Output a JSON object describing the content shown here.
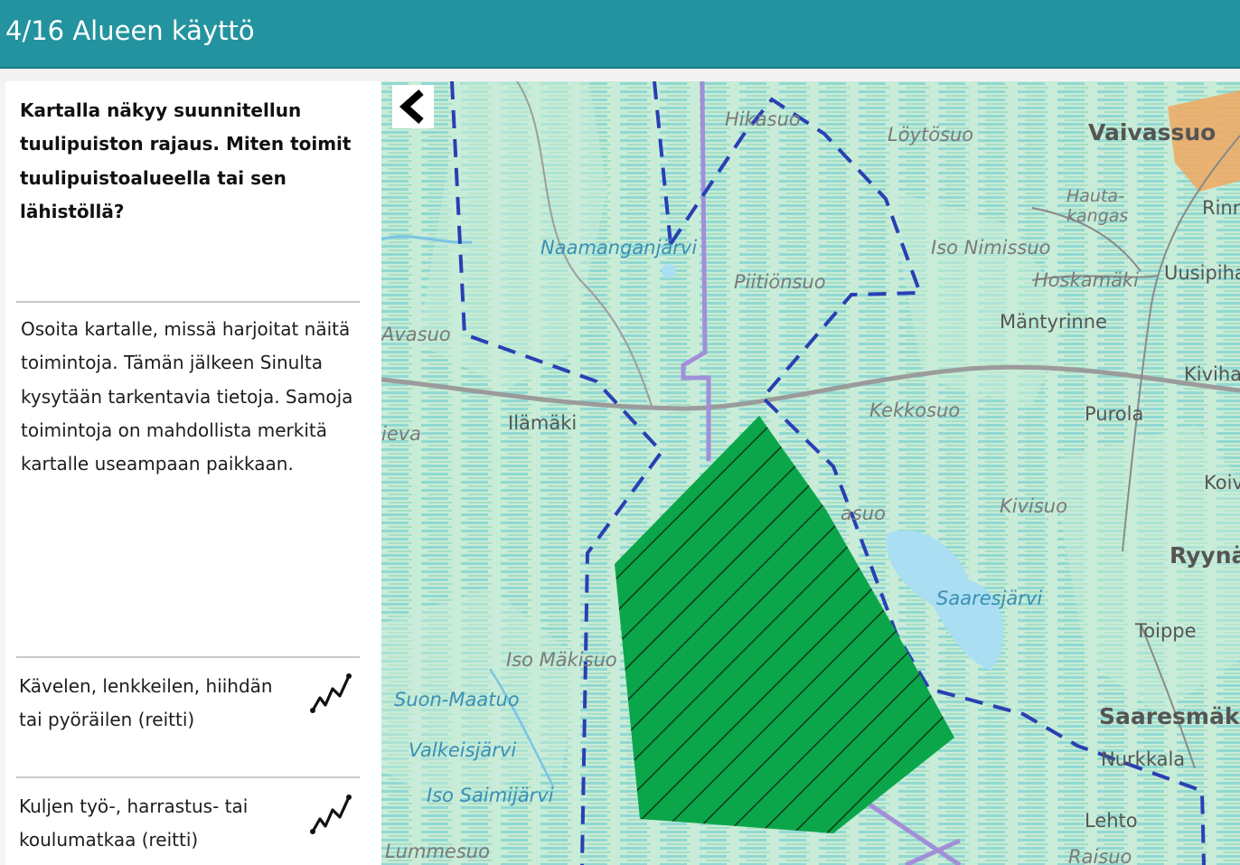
{
  "header": {
    "title": "4/16 Alueen käyttö"
  },
  "panel": {
    "question": "Kartalla näkyy suunnitellun tuulipuiston rajaus. Miten toimit tuulipuistoalueella tai sen lähistöllä?",
    "instructions": "Osoita kartalle, missä harjoitat näitä toimintoja. Tämän jälkeen Sinulta kysytään tarkentavia tietoja. Samoja toimintoja on mahdollista merkitä kartalle useampaan paikkaan.",
    "options": [
      {
        "label": "Kävelen, lenkkeilen, hiihdän tai pyöräilen (reitti)",
        "icon": "route-icon"
      },
      {
        "label": "Kuljen työ-, harrastus- tai koulumatkaa (reitti)",
        "icon": "route-icon"
      }
    ]
  },
  "map": {
    "collapse_icon": "chevron-left-icon",
    "colors": {
      "area_fill": "#0ca64a",
      "boundary": "#2a3fb3",
      "road": "#a79fd0",
      "water": "#a9def3",
      "settlement": "#f0a860"
    },
    "labels": [
      {
        "text": "Vaivassuo",
        "style": "big"
      },
      {
        "text": "Löytösuo",
        "style": "place"
      },
      {
        "text": "Hikasuo",
        "style": "place"
      },
      {
        "text": "Hauta-\nkangas",
        "style": "place"
      },
      {
        "text": "Rinn",
        "style": "plain"
      },
      {
        "text": "Naamanganjärvi",
        "style": "water"
      },
      {
        "text": "Iso Nimissuo",
        "style": "place"
      },
      {
        "text": "Hoskamäki",
        "style": "place"
      },
      {
        "text": "Uusipiha",
        "style": "plain"
      },
      {
        "text": "Piitiönsuo",
        "style": "place"
      },
      {
        "text": "Mäntyrinne",
        "style": "plain"
      },
      {
        "text": "Avasuo",
        "style": "place"
      },
      {
        "text": "Kivihar",
        "style": "plain"
      },
      {
        "text": "Ilämäki",
        "style": "plain"
      },
      {
        "text": "Kekkosuo",
        "style": "place"
      },
      {
        "text": "Purola",
        "style": "plain"
      },
      {
        "text": "ieva",
        "style": "place"
      },
      {
        "text": "Koivu",
        "style": "plain"
      },
      {
        "text": "Kivisuo",
        "style": "place"
      },
      {
        "text": "asuo",
        "style": "place"
      },
      {
        "text": "Ryynä",
        "style": "big"
      },
      {
        "text": "Saaresjärvi",
        "style": "water"
      },
      {
        "text": "Toippe",
        "style": "plain"
      },
      {
        "text": "Iso Mäkisuo",
        "style": "place"
      },
      {
        "text": "Suon-Maatuo",
        "style": "water"
      },
      {
        "text": "Saaresmäki",
        "style": "big"
      },
      {
        "text": "Valkeisjärvi",
        "style": "water"
      },
      {
        "text": "Nurkkala",
        "style": "plain"
      },
      {
        "text": "Iso Saimijärvi",
        "style": "water"
      },
      {
        "text": "Lehto",
        "style": "plain"
      },
      {
        "text": "Lummesuo",
        "style": "place"
      },
      {
        "text": "Raisuo",
        "style": "place"
      }
    ]
  }
}
